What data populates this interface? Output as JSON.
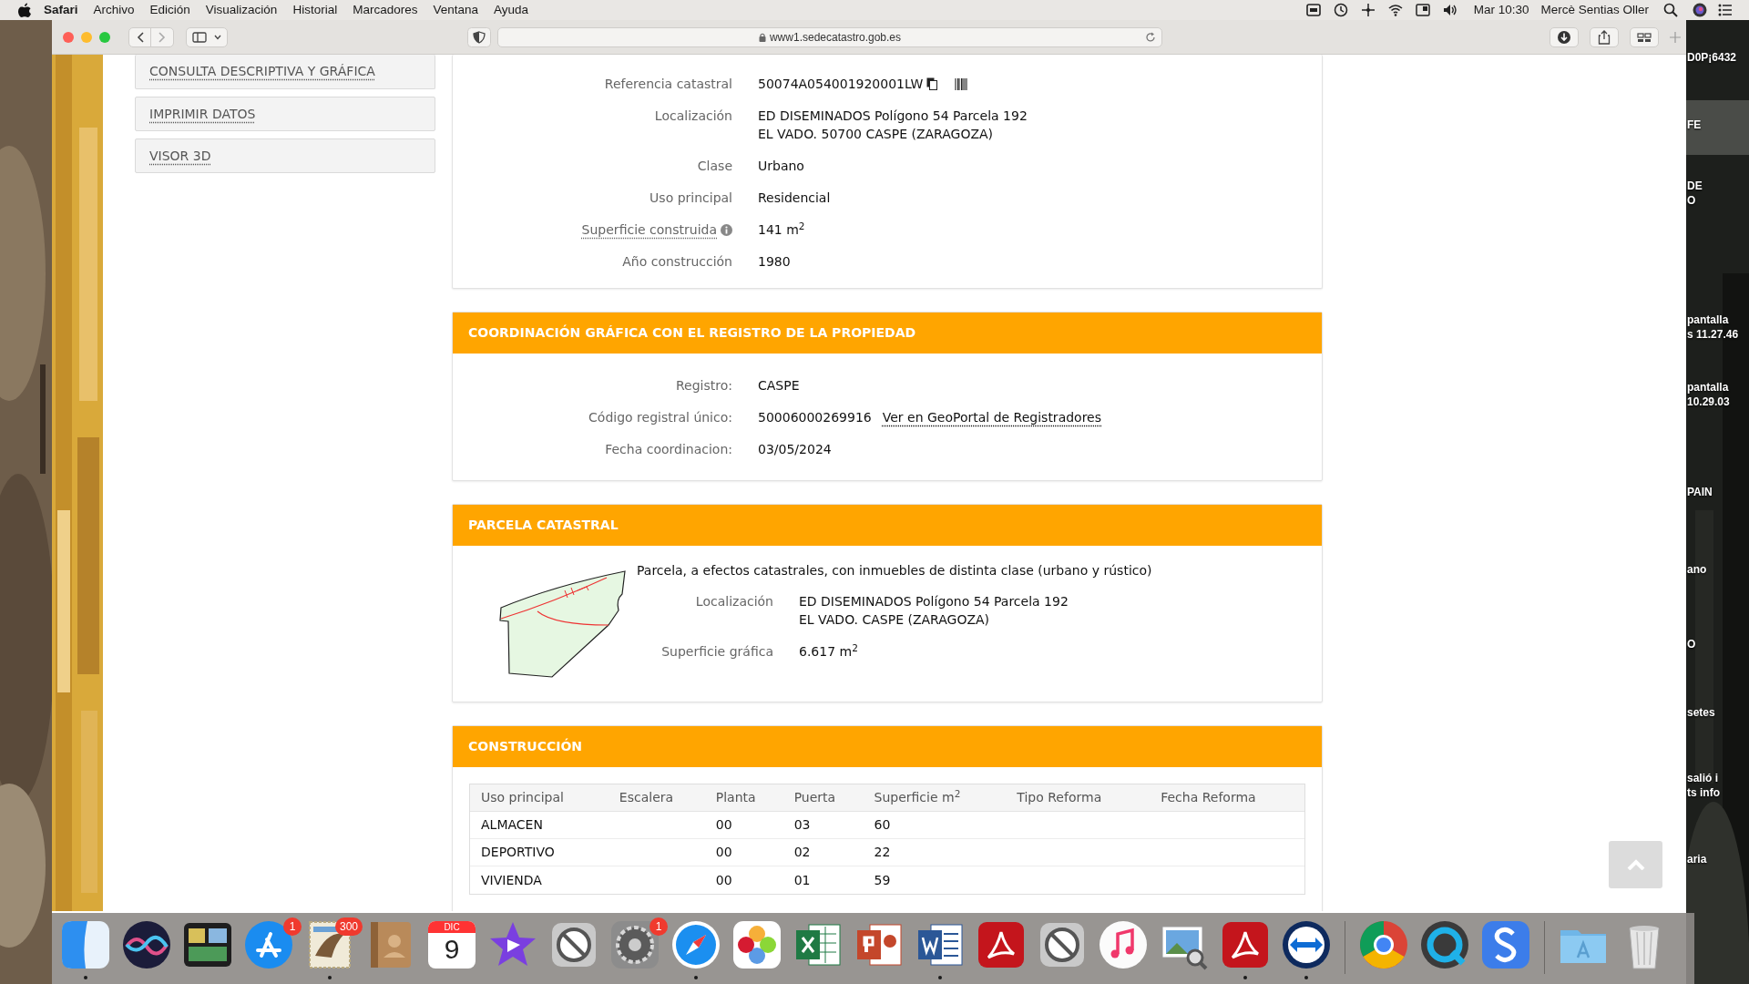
{
  "menu_bar": {
    "app": "Safari",
    "items": [
      "Archivo",
      "Edición",
      "Visualización",
      "Historial",
      "Marcadores",
      "Ventana",
      "Ayuda"
    ],
    "clock": "Mar 10:30",
    "user": "Mercè Sentias Oller"
  },
  "browser": {
    "url": "www1.sedecatastro.gob.es"
  },
  "sidebar": {
    "items": [
      "CONSULTA DESCRIPTIVA Y GRÁFICA",
      "IMPRIMIR DATOS",
      "VISOR 3D"
    ]
  },
  "inmueble": {
    "rows": [
      {
        "kind": "reference",
        "label": "Referencia catastral",
        "lines": [
          "50074A054001920001LW"
        ]
      },
      {
        "kind": "plain",
        "label": "Localización",
        "lines": [
          "ED DISEMINADOS Polígono 54 Parcela 192",
          "EL VADO. 50700 CASPE (ZARAGOZA)"
        ]
      },
      {
        "kind": "plain",
        "label": "Clase",
        "lines": [
          "Urbano"
        ]
      },
      {
        "kind": "plain",
        "label": "Uso principal",
        "lines": [
          "Residencial"
        ]
      },
      {
        "kind": "info",
        "label": "Superficie construida",
        "lines": [
          "141 m$^{2}$"
        ]
      },
      {
        "kind": "plain",
        "label": "Año construcción",
        "lines": [
          "1980"
        ]
      }
    ]
  },
  "coordinacion": {
    "title": "COORDINACIÓN GRÁFICA CON EL REGISTRO DE LA PROPIEDAD",
    "rows": [
      {
        "kind": "plain",
        "label": "Registro:",
        "lines": [
          "CASPE"
        ]
      },
      {
        "kind": "link",
        "label": "Código registral único:",
        "lines": [
          "50006000269916"
        ],
        "link": "Ver en GeoPortal de Registradores"
      },
      {
        "kind": "plain",
        "label": "Fecha coordinacion:",
        "lines": [
          "03/05/2024"
        ]
      }
    ]
  },
  "parcela": {
    "title": "PARCELA CATASTRAL",
    "description": "Parcela, a efectos catastrales, con inmuebles de distinta clase (urbano y rústico)",
    "rows": [
      {
        "label": "Localización",
        "lines": [
          "ED DISEMINADOS Polígono 54 Parcela 192",
          "EL VADO. CASPE (ZARAGOZA)"
        ]
      },
      {
        "label": "Superficie gráfica",
        "lines": [
          "6.617 m$^{2}$"
        ]
      }
    ]
  },
  "construccion": {
    "title": "CONSTRUCCIÓN",
    "columns": [
      "Uso principal",
      "Escalera",
      "Planta",
      "Puerta",
      "Superficie m$^{2}$",
      "Tipo Reforma",
      "Fecha Reforma"
    ],
    "rows": [
      [
        "ALMACEN",
        "",
        "00",
        "03",
        "60",
        "",
        ""
      ],
      [
        "DEPORTIVO",
        "",
        "00",
        "02",
        "22",
        "",
        ""
      ],
      [
        "VIVIENDA",
        "",
        "00",
        "01",
        "59",
        "",
        ""
      ]
    ]
  },
  "desktop_labels": [
    {
      "lines": [
        "D0P¡6432"
      ]
    },
    {
      "lines": [
        "FE"
      ]
    },
    {
      "lines": [
        "DE",
        "O"
      ]
    },
    {
      "lines": [
        "pantalla",
        "s 11.27.46"
      ]
    },
    {
      "lines": [
        "pantalla",
        "10.29.03"
      ]
    },
    {
      "lines": [
        "PAIN"
      ]
    },
    {
      "lines": [
        "ano"
      ]
    },
    {
      "lines": [
        "O"
      ]
    },
    {
      "lines": [
        "setes"
      ]
    },
    {
      "lines": [
        "salió i",
        "ts info"
      ]
    },
    {
      "lines": [
        "aria"
      ]
    }
  ],
  "dock": {
    "groups": [
      {
        "items": [
          {
            "kind": "finder",
            "running": true
          },
          {
            "kind": "siri",
            "running": false
          },
          {
            "kind": "panels",
            "running": false
          },
          {
            "kind": "appstore",
            "running": false,
            "badge": "1"
          },
          {
            "kind": "stamp",
            "running": true,
            "badge": "300"
          },
          {
            "kind": "book",
            "running": false
          },
          {
            "kind": "calendar",
            "running": false,
            "month": "DIC",
            "day": "9"
          },
          {
            "kind": "star",
            "running": false
          },
          {
            "kind": "blocked",
            "running": false
          },
          {
            "kind": "gear",
            "running": false,
            "badge": "1"
          },
          {
            "kind": "compass",
            "running": true
          },
          {
            "kind": "flower",
            "running": false
          },
          {
            "kind": "sheet",
            "running": false
          },
          {
            "kind": "slides",
            "running": false
          },
          {
            "kind": "doc",
            "running": true
          },
          {
            "kind": "swirl",
            "running": false
          },
          {
            "kind": "blocked",
            "running": false
          },
          {
            "kind": "note",
            "running": false
          },
          {
            "kind": "viewer",
            "running": false
          },
          {
            "kind": "swirl",
            "running": true
          },
          {
            "kind": "arrows",
            "running": true
          }
        ]
      },
      {
        "items": [
          {
            "kind": "wheel",
            "running": false
          },
          {
            "kind": "ring",
            "running": false
          },
          {
            "kind": "hook",
            "running": false
          }
        ]
      },
      {
        "items": [
          {
            "kind": "folder",
            "running": false
          },
          {
            "kind": "trash",
            "running": false
          }
        ]
      }
    ]
  }
}
